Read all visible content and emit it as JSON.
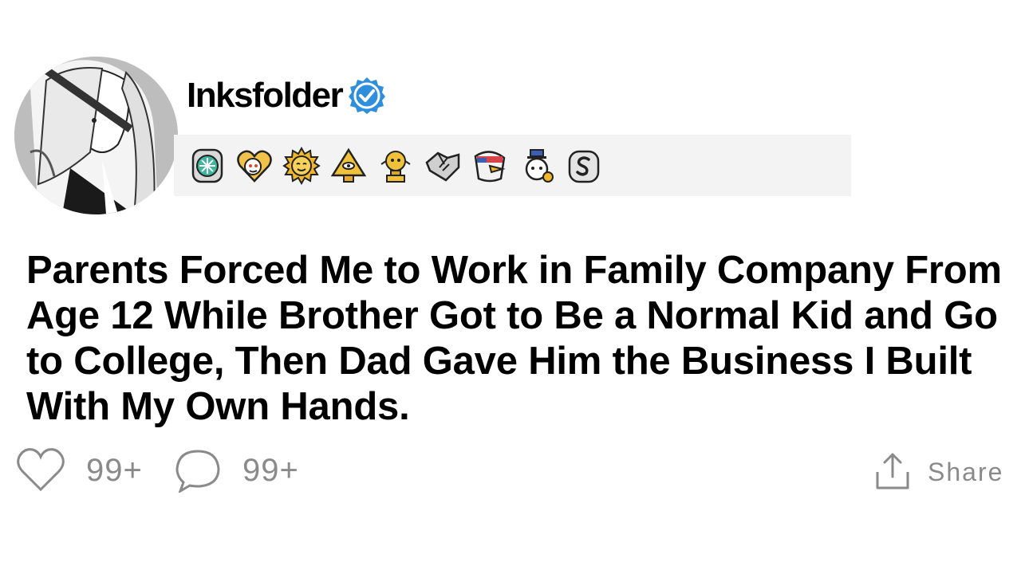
{
  "post": {
    "username": "Inksfolder",
    "verified_icon": "verified-badge-icon",
    "title": "Parents Forced Me to Work in Family Company From Age 12 While Brother Got to Be a Normal Kid and Go to College, Then Dad Gave Him the Business I Built With My Own Hands."
  },
  "awards": [
    {
      "icon": "gem-award-icon"
    },
    {
      "icon": "wholesome-heart-award-icon"
    },
    {
      "icon": "sun-face-award-icon"
    },
    {
      "icon": "illuminati-pyramid-award-icon"
    },
    {
      "icon": "gold-trophy-award-icon"
    },
    {
      "icon": "handshake-award-icon"
    },
    {
      "icon": "eagle-award-icon"
    },
    {
      "icon": "snoo-helper-award-icon"
    },
    {
      "icon": "silver-coin-award-icon"
    }
  ],
  "actions": {
    "likes": "99+",
    "comments": "99+",
    "share_label": "Share"
  },
  "colors": {
    "verified_blue": "#2f8fdc",
    "muted_gray": "#8a8a8a",
    "award_strip_bg": "#f3f3f3"
  }
}
